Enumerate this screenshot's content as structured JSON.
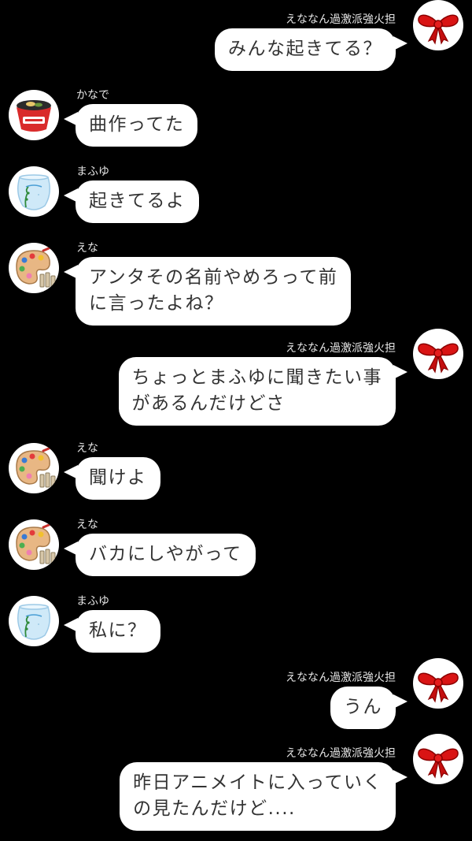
{
  "messages": [
    {
      "side": "right",
      "sender": "えななん過激派強火担",
      "avatar": "red-ribbon-icon",
      "lines": [
        "みんな起きてる？"
      ]
    },
    {
      "side": "left",
      "sender": "かなで",
      "avatar": "ramen-cup-icon",
      "lines": [
        "曲作ってた"
      ]
    },
    {
      "side": "left",
      "sender": "まふゆ",
      "avatar": "fishbowl-icon",
      "lines": [
        "起きてるよ"
      ]
    },
    {
      "side": "left",
      "sender": "えな",
      "avatar": "paint-palette-icon",
      "lines": [
        "アンタその名前やめろって前",
        "に言ったよね？"
      ]
    },
    {
      "side": "right",
      "sender": "えななん過激派強火担",
      "avatar": "red-ribbon-icon",
      "lines": [
        "ちょっとまふゆに聞きたい事",
        "があるんだけどさ"
      ]
    },
    {
      "side": "left",
      "sender": "えな",
      "avatar": "paint-palette-icon",
      "lines": [
        "聞けよ"
      ]
    },
    {
      "side": "left",
      "sender": "えな",
      "avatar": "paint-palette-icon",
      "lines": [
        "バカにしやがって"
      ]
    },
    {
      "side": "left",
      "sender": "まふゆ",
      "avatar": "fishbowl-icon",
      "lines": [
        "私に？"
      ]
    },
    {
      "side": "right",
      "sender": "えななん過激派強火担",
      "avatar": "red-ribbon-icon",
      "lines": [
        "うん"
      ]
    },
    {
      "side": "right",
      "sender": "えななん過激派強火担",
      "avatar": "red-ribbon-icon",
      "lines": [
        "昨日アニメイトに入っていく",
        "の見たんだけど...."
      ]
    }
  ],
  "colors": {
    "background": "#000000",
    "bubble": "#ffffff",
    "text": "#333333",
    "sender": "#e6e6e6"
  }
}
